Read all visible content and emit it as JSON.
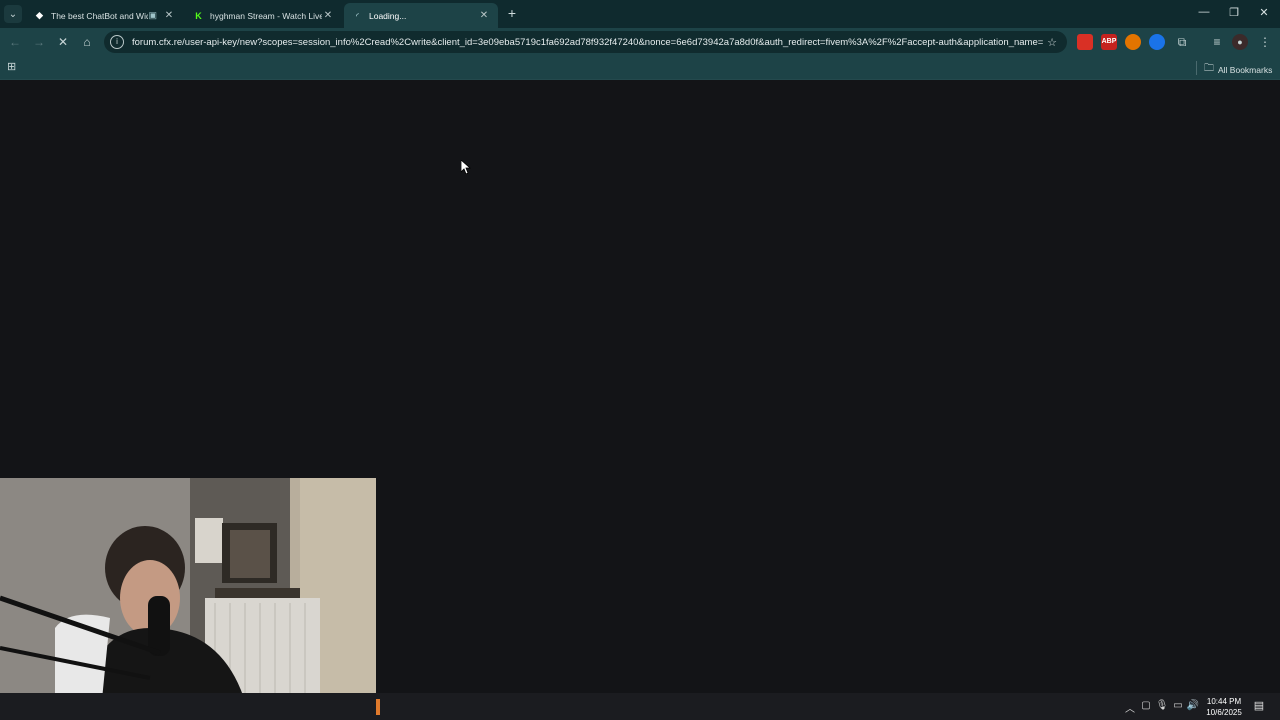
{
  "tabs": [
    {
      "title": "The best ChatBot and Widg",
      "favicon": "diamond-icon",
      "has_audio_icon": true,
      "active": false
    },
    {
      "title": "hyghman Stream - Watch Live o",
      "favicon": "kick-logo-icon",
      "has_audio_icon": false,
      "active": false
    },
    {
      "title": "Loading...",
      "favicon": "loading-spinner-icon",
      "has_audio_icon": false,
      "active": true
    }
  ],
  "address_bar": {
    "url": "forum.cfx.re/user-api-key/new?scopes=session_info%2Cread%2Cwrite&client_id=3e09eba5719c1fa692ad78f932f47240&nonce=6e6d73942a7a8d0f&auth_redirect=fivem%3A%2F%2Faccept-auth&application_name=Five..."
  },
  "bookmarks_bar": {
    "all_bookmarks_label": "All Bookmarks"
  },
  "extensions": [
    {
      "name": "shield-extension-icon",
      "color": "#d93025",
      "label": ""
    },
    {
      "name": "adblock-plus-icon",
      "color": "#c5221f",
      "label": "ABP"
    },
    {
      "name": "orange-extension-icon",
      "color": "#e37400",
      "label": ""
    },
    {
      "name": "blue-extension-icon",
      "color": "#1a73e8",
      "label": ""
    }
  ],
  "taskbar": {
    "time": "10:44 PM",
    "date": "10/6/2025"
  },
  "colors": {
    "tabstrip": "#0f2a2e",
    "toolbar": "#1d4347",
    "page_background": "#131417",
    "taskbar": "#1b1c20"
  }
}
